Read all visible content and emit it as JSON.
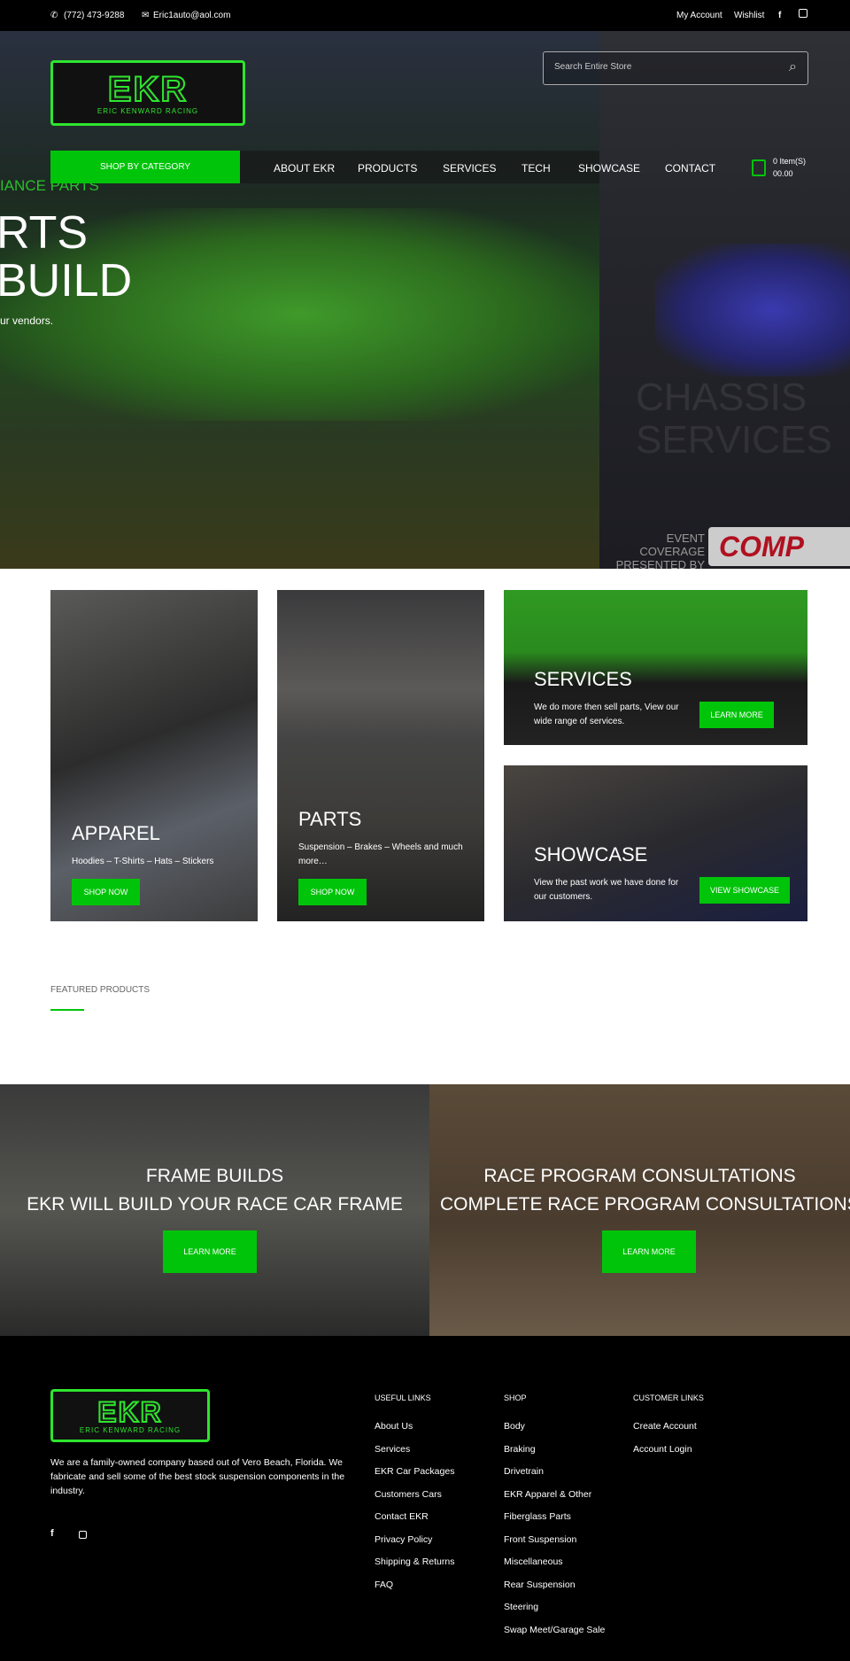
{
  "topbar": {
    "phone": "(772) 473-9288",
    "email": "Eric1auto@aol.com",
    "my_account": "My Account",
    "wishlist": "Wishlist"
  },
  "logo": {
    "text": "EKR",
    "tagline": "ERIC KENWARD RACING"
  },
  "search": {
    "placeholder": "Search Entire Store"
  },
  "nav": {
    "shop_by_category": "SHOP BY CATEGORY",
    "items": [
      "ABOUT EKR",
      "PRODUCTS",
      "SERVICES",
      "TECH",
      "SHOWCASE",
      "CONTACT"
    ]
  },
  "cart": {
    "items": "0 Item(S)",
    "total": "00.00"
  },
  "hero": {
    "subtitle": "IANCE PARTS",
    "line1": "RTS",
    "line2": "BUILD",
    "desc": "ur vendors.",
    "right_faint": "CHASSIS SERVICES",
    "sponsor_text": "EVENT COVERAGE PRESENTED BY",
    "sponsor_logo": "COMP CAMS"
  },
  "cards": [
    {
      "title": "APPAREL",
      "desc": "Hoodies – T-Shirts – Hats – Stickers",
      "button": "SHOP NOW"
    },
    {
      "title": "PARTS",
      "desc": "Suspension – Brakes – Wheels and much more…",
      "button": "SHOP NOW"
    },
    {
      "title": "SERVICES",
      "desc": "We do more then sell parts, View our wide range of services.",
      "button": "LEARN MORE"
    },
    {
      "title": "SHOWCASE",
      "desc": "View the past work we have done for our customers.",
      "button": "VIEW SHOWCASE"
    }
  ],
  "featured": {
    "title": "FEATURED PRODUCTS"
  },
  "banners": [
    {
      "title": "FRAME BUILDS",
      "subtitle": "EKR WILL BUILD YOUR RACE CAR FRAME",
      "button": "LEARN MORE"
    },
    {
      "title": "RACE PROGRAM CONSULTATIONS",
      "subtitle": "COMPLETE RACE PROGRAM CONSULTATIONS",
      "button": "LEARN MORE"
    }
  ],
  "footer": {
    "about": "We are a family-owned company based out of Vero Beach, Florida. We fabricate and sell some of the best stock suspension components in the industry.",
    "useful_title": "USEFUL LINKS",
    "useful": [
      "About Us",
      "Services",
      "EKR Car Packages",
      "Customers Cars",
      "Contact EKR",
      "Privacy Policy",
      "Shipping & Returns",
      "FAQ"
    ],
    "shop_title": "SHOP",
    "shop": [
      "Body",
      "Braking",
      "Drivetrain",
      "EKR Apparel & Other",
      "Fiberglass Parts",
      "Front Suspension",
      "Miscellaneous",
      "Rear Suspension",
      "Steering",
      "Swap Meet/Garage Sale"
    ],
    "customer_title": "CUSTOMER LINKS",
    "customer": [
      "Create Account",
      "Account Login"
    ]
  },
  "colors": {
    "accent": "#00c40a",
    "background_dark": "#000000"
  }
}
